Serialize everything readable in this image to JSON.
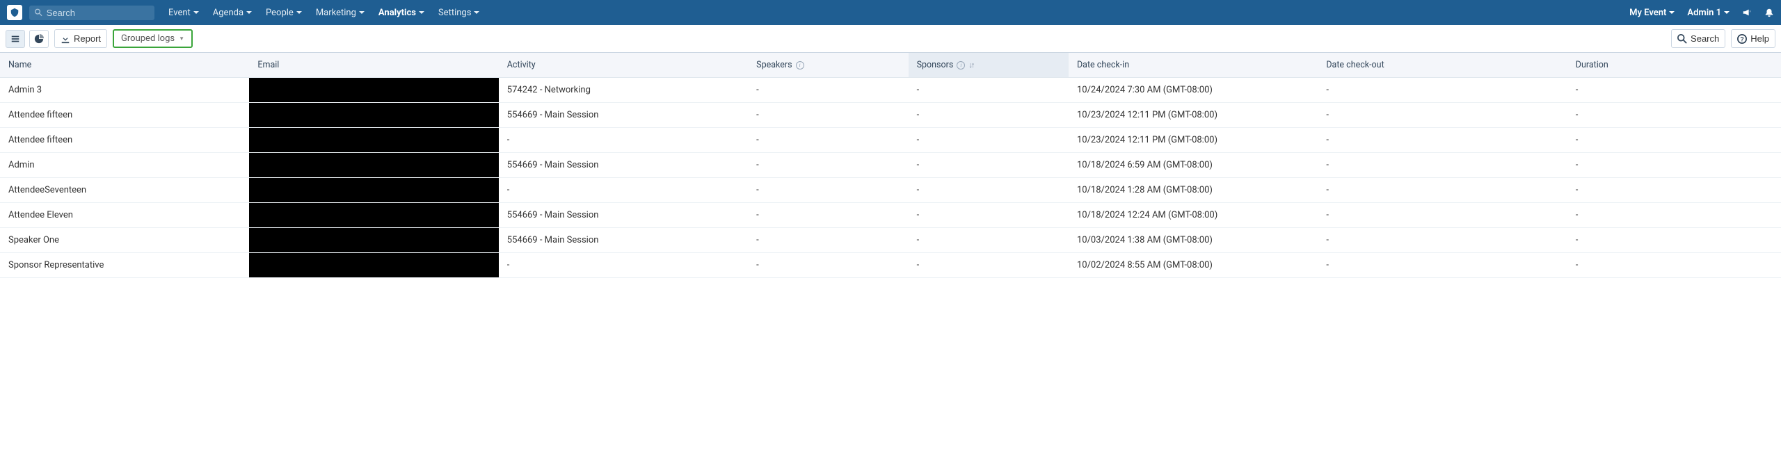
{
  "topbar": {
    "search_placeholder": "Search",
    "nav": [
      {
        "label": "Event",
        "active": false
      },
      {
        "label": "Agenda",
        "active": false
      },
      {
        "label": "People",
        "active": false
      },
      {
        "label": "Marketing",
        "active": false
      },
      {
        "label": "Analytics",
        "active": true
      },
      {
        "label": "Settings",
        "active": false
      }
    ],
    "event_label": "My Event",
    "user_label": "Admin 1"
  },
  "toolbar": {
    "report_label": "Report",
    "grouped_logs_label": "Grouped logs",
    "search_label": "Search",
    "help_label": "Help"
  },
  "table": {
    "columns": {
      "name": "Name",
      "email": "Email",
      "activity": "Activity",
      "speakers": "Speakers",
      "sponsors": "Sponsors",
      "checkin": "Date check-in",
      "checkout": "Date check-out",
      "duration": "Duration"
    },
    "rows": [
      {
        "name": "Admin 3",
        "email": "",
        "activity": "574242 - Networking",
        "speakers": "-",
        "sponsors": "-",
        "checkin": "10/24/2024 7:30 AM (GMT-08:00)",
        "checkout": "-",
        "duration": "-"
      },
      {
        "name": "Attendee fifteen",
        "email": "",
        "activity": "554669 - Main Session",
        "speakers": "-",
        "sponsors": "-",
        "checkin": "10/23/2024 12:11 PM (GMT-08:00)",
        "checkout": "-",
        "duration": "-"
      },
      {
        "name": "Attendee fifteen",
        "email": "",
        "activity": "-",
        "speakers": "-",
        "sponsors": "-",
        "checkin": "10/23/2024 12:11 PM (GMT-08:00)",
        "checkout": "-",
        "duration": "-"
      },
      {
        "name": "Admin",
        "email": "",
        "activity": "554669 - Main Session",
        "speakers": "-",
        "sponsors": "-",
        "checkin": "10/18/2024 6:59 AM (GMT-08:00)",
        "checkout": "-",
        "duration": "-"
      },
      {
        "name": "AttendeeSeventeen",
        "email": "",
        "activity": "-",
        "speakers": "-",
        "sponsors": "-",
        "checkin": "10/18/2024 1:28 AM (GMT-08:00)",
        "checkout": "-",
        "duration": "-"
      },
      {
        "name": "Attendee Eleven",
        "email": "",
        "activity": "554669 - Main Session",
        "speakers": "-",
        "sponsors": "-",
        "checkin": "10/18/2024 12:24 AM (GMT-08:00)",
        "checkout": "-",
        "duration": "-"
      },
      {
        "name": "Speaker One",
        "email": "",
        "activity": "554669 - Main Session",
        "speakers": "-",
        "sponsors": "-",
        "checkin": "10/03/2024 1:38 AM (GMT-08:00)",
        "checkout": "-",
        "duration": "-"
      },
      {
        "name": "Sponsor Representative",
        "email": "",
        "activity": "-",
        "speakers": "-",
        "sponsors": "-",
        "checkin": "10/02/2024 8:55 AM (GMT-08:00)",
        "checkout": "-",
        "duration": "-"
      }
    ]
  }
}
